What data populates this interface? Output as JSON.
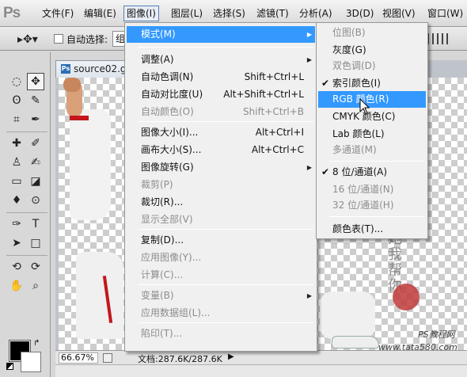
{
  "app": {
    "logo": "Ps"
  },
  "menubar": {
    "items": [
      "文件(F)",
      "编辑(E)",
      "图像(I)",
      "图层(L)",
      "选择(S)",
      "滤镜(T)",
      "分析(A)",
      "3D(D)",
      "视图(V)",
      "窗口(W)"
    ]
  },
  "options": {
    "auto_select_label": "自动选择:",
    "group_value": "组"
  },
  "document": {
    "tab_icon": "Ps",
    "tab_title": "source02.g",
    "zoom": "66.67%",
    "doc_info": "文档:287.6K/287.6K"
  },
  "image_menu": [
    {
      "label": "模式(M)",
      "shortcut": "",
      "submenu": true,
      "highlighted": true,
      "disabled": false
    },
    {
      "label": "调整(A)",
      "shortcut": "",
      "submenu": true,
      "highlighted": false,
      "disabled": false
    },
    {
      "label": "自动色调(N)",
      "shortcut": "Shift+Ctrl+L",
      "submenu": false,
      "highlighted": false,
      "disabled": false
    },
    {
      "label": "自动对比度(U)",
      "shortcut": "Alt+Shift+Ctrl+L",
      "submenu": false,
      "highlighted": false,
      "disabled": false
    },
    {
      "label": "自动颜色(O)",
      "shortcut": "Shift+Ctrl+B",
      "submenu": false,
      "highlighted": false,
      "disabled": true
    },
    {
      "label": "图像大小(I)...",
      "shortcut": "Alt+Ctrl+I",
      "submenu": false,
      "highlighted": false,
      "disabled": false
    },
    {
      "label": "画布大小(S)...",
      "shortcut": "Alt+Ctrl+C",
      "submenu": false,
      "highlighted": false,
      "disabled": false
    },
    {
      "label": "图像旋转(G)",
      "shortcut": "",
      "submenu": true,
      "highlighted": false,
      "disabled": false
    },
    {
      "label": "裁剪(P)",
      "shortcut": "",
      "submenu": false,
      "highlighted": false,
      "disabled": true
    },
    {
      "label": "裁切(R)...",
      "shortcut": "",
      "submenu": false,
      "highlighted": false,
      "disabled": false
    },
    {
      "label": "显示全部(V)",
      "shortcut": "",
      "submenu": false,
      "highlighted": false,
      "disabled": true
    },
    {
      "label": "复制(D)...",
      "shortcut": "",
      "submenu": false,
      "highlighted": false,
      "disabled": false
    },
    {
      "label": "应用图像(Y)...",
      "shortcut": "",
      "submenu": false,
      "highlighted": false,
      "disabled": true
    },
    {
      "label": "计算(C)...",
      "shortcut": "",
      "submenu": false,
      "highlighted": false,
      "disabled": true
    },
    {
      "label": "变量(B)",
      "shortcut": "",
      "submenu": true,
      "highlighted": false,
      "disabled": true
    },
    {
      "label": "应用数据组(L)...",
      "shortcut": "",
      "submenu": false,
      "highlighted": false,
      "disabled": true
    },
    {
      "label": "陷印(T)...",
      "shortcut": "",
      "submenu": false,
      "highlighted": false,
      "disabled": true
    }
  ],
  "mode_menu": [
    {
      "label": "位图(B)",
      "checked": false,
      "highlighted": false,
      "disabled": true
    },
    {
      "label": "灰度(G)",
      "checked": false,
      "highlighted": false,
      "disabled": false
    },
    {
      "label": "双色调(D)",
      "checked": false,
      "highlighted": false,
      "disabled": true
    },
    {
      "label": "索引颜色(I)",
      "checked": true,
      "highlighted": false,
      "disabled": false
    },
    {
      "label": "RGB 颜色(R)",
      "checked": false,
      "highlighted": true,
      "disabled": false
    },
    {
      "label": "CMYK 颜色(C)",
      "checked": false,
      "highlighted": false,
      "disabled": false
    },
    {
      "label": "Lab 颜色(L)",
      "checked": false,
      "highlighted": false,
      "disabled": false
    },
    {
      "label": "多通道(M)",
      "checked": false,
      "highlighted": false,
      "disabled": true
    },
    {
      "label": "8 位/通道(A)",
      "checked": true,
      "highlighted": false,
      "disabled": false
    },
    {
      "label": "16 位/通道(N)",
      "checked": false,
      "highlighted": false,
      "disabled": true
    },
    {
      "label": "32 位/通道(H)",
      "checked": false,
      "highlighted": false,
      "disabled": true
    },
    {
      "label": "颜色表(T)...",
      "checked": false,
      "highlighted": false,
      "disabled": false
    }
  ],
  "watermark": {
    "calligraphy": "他她我帮你",
    "line1": "PS教程网",
    "line2": "www.tata580.com"
  },
  "colors": {
    "highlight": "#3399ff",
    "foreground": "#000000",
    "background": "#ffffff"
  }
}
